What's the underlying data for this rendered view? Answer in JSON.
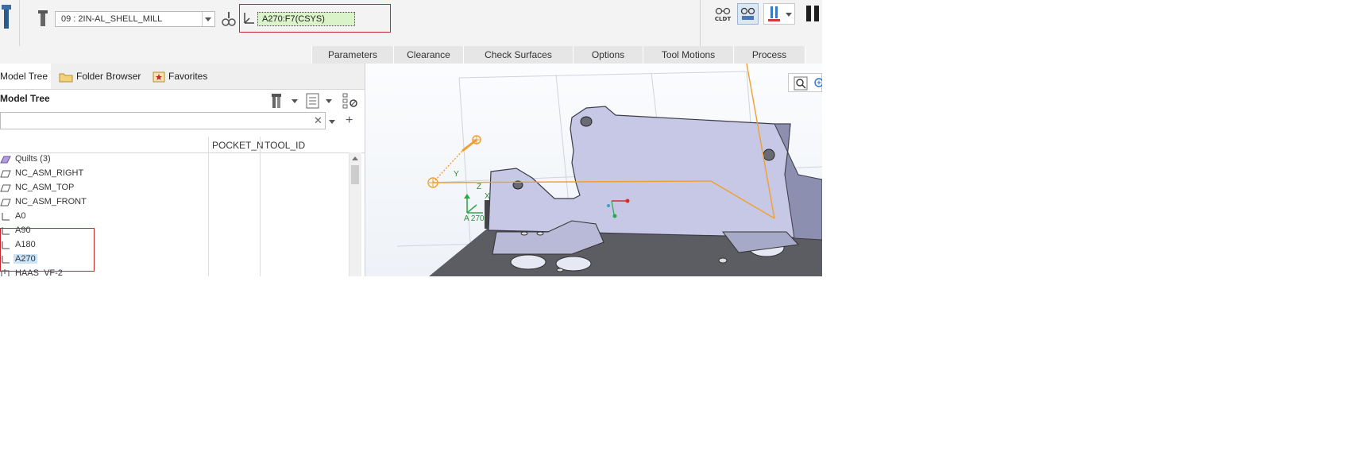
{
  "dashboard": {
    "tool_select": {
      "value": "09 : 2IN-AL_SHELL_MILL"
    },
    "csys_field": {
      "value": "A270:F7(CSYS)"
    },
    "cldt_label": "CLDT"
  },
  "tabs": [
    {
      "label": "Parameters"
    },
    {
      "label": "Clearance"
    },
    {
      "label": "Check Surfaces"
    },
    {
      "label": "Options"
    },
    {
      "label": "Tool Motions"
    },
    {
      "label": "Process"
    }
  ],
  "left_panel": {
    "nav_tabs": [
      {
        "label": "Model Tree",
        "icon": "model-tree-icon"
      },
      {
        "label": "Folder Browser",
        "icon": "folder-icon"
      },
      {
        "label": "Favorites",
        "icon": "star-icon"
      }
    ],
    "title": "Model Tree",
    "search": {
      "value": ""
    },
    "columns": [
      {
        "label": "POCKET_N"
      },
      {
        "label": "TOOL_ID"
      }
    ],
    "tree_items": [
      {
        "label": "Quilts (3)",
        "icon": "quilt-icon"
      },
      {
        "label": "NC_ASM_RIGHT",
        "icon": "datum-plane-icon"
      },
      {
        "label": "NC_ASM_TOP",
        "icon": "datum-plane-icon"
      },
      {
        "label": "NC_ASM_FRONT",
        "icon": "datum-plane-icon"
      },
      {
        "label": "A0",
        "icon": "csys-icon"
      },
      {
        "label": "A90",
        "icon": "csys-icon"
      },
      {
        "label": "A180",
        "icon": "csys-icon"
      },
      {
        "label": "A270",
        "icon": "csys-icon",
        "selected": true
      },
      {
        "label": "HAAS_VF-2",
        "icon": "workcell-icon"
      }
    ]
  },
  "viewport": {
    "csys_triad_label": "A 270",
    "axis_labels": {
      "x": "X",
      "y": "Y",
      "z": "Z"
    },
    "colors": {
      "part_face": "#c6c8e6",
      "part_side": "#5c5c63",
      "toolpath": "#f0a030",
      "triad": "#2ea84a"
    }
  }
}
